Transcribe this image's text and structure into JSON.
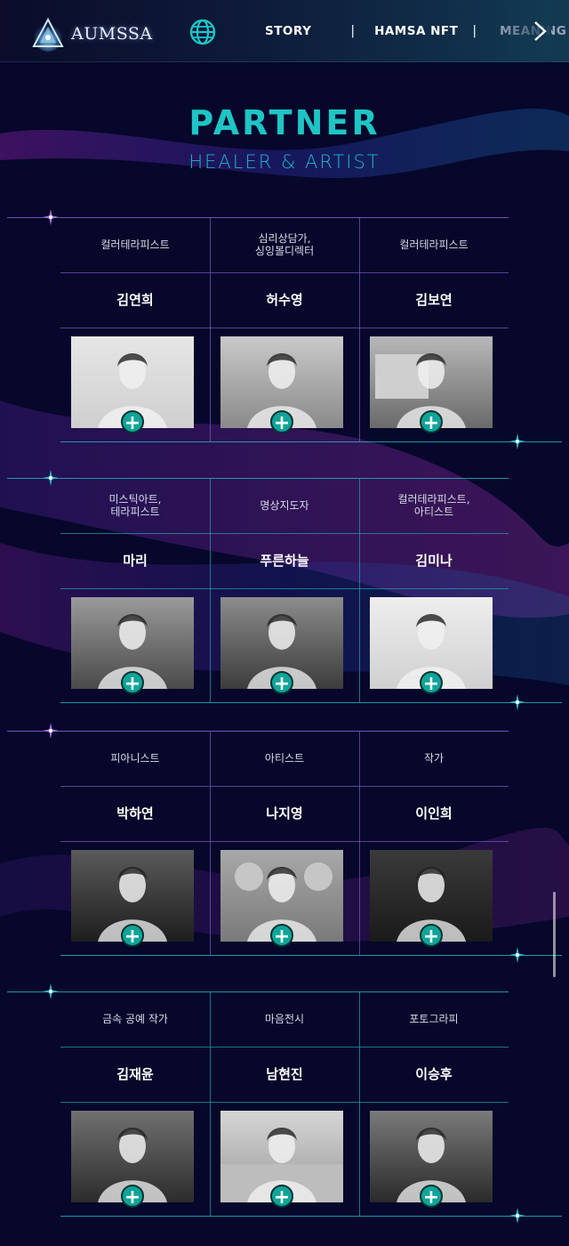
{
  "header": {
    "logo_text": "AUMSSA",
    "nav": [
      "STORY",
      "HAMSA NFT",
      "MEANING"
    ],
    "separator": "|"
  },
  "title": "PARTNER",
  "subtitle": "HEALER & ARTIST",
  "groups": [
    {
      "members": [
        {
          "role": "컬러테라피스트",
          "name": "김연희",
          "photo": "woman-white-top"
        },
        {
          "role": "심리상담가,\n싱잉볼디렉터",
          "name": "허수영",
          "photo": "woman-plants"
        },
        {
          "role": "컬러테라피스트",
          "name": "김보연",
          "photo": "woman-hat-color-bottles"
        }
      ]
    },
    {
      "members": [
        {
          "role": "미스틱아트,\n테라피스트",
          "name": "마리",
          "photo": "woman-sunglasses-selfie"
        },
        {
          "role": "명상지도자",
          "name": "푸른하늘",
          "photo": "man-martial-arts-forest"
        },
        {
          "role": "컬러테라피스트,\n아티스트",
          "name": "김미나",
          "photo": "woman-with-baby"
        }
      ]
    },
    {
      "members": [
        {
          "role": "피아니스트",
          "name": "박하연",
          "photo": "woman-piano"
        },
        {
          "role": "아티스트",
          "name": "나지영",
          "photo": "woman-flower-paintings"
        },
        {
          "role": "작가",
          "name": "이인희",
          "photo": "woman-hair-closeup"
        }
      ]
    },
    {
      "members": [
        {
          "role": "금속 공예 작가",
          "name": "김재윤",
          "photo": "man-metal-craft"
        },
        {
          "role": "마음전시",
          "name": "남현진",
          "photo": "woman-seaside-smile"
        },
        {
          "role": "포토그라피",
          "name": "이승후",
          "photo": "man-camera-mask"
        }
      ]
    }
  ],
  "plus_label": "+",
  "colors": {
    "accent_teal": "#1ec5c5",
    "background": "#06072a",
    "plus_button": "#0fa49a"
  }
}
